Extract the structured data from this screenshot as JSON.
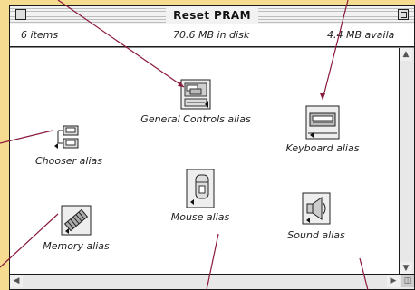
{
  "window": {
    "title": "Reset PRAM",
    "item_count": "6 items",
    "disk_usage": "70.6 MB in disk",
    "available": "4.4 MB availa"
  },
  "icons": [
    {
      "name": "general-controls",
      "label": "General Controls alias"
    },
    {
      "name": "chooser",
      "label": "Chooser alias"
    },
    {
      "name": "keyboard",
      "label": "Keyboard alias"
    },
    {
      "name": "mouse",
      "label": "Mouse alias"
    },
    {
      "name": "memory",
      "label": "Memory alias"
    },
    {
      "name": "sound",
      "label": "Sound alias"
    }
  ],
  "colors": {
    "background": "#f6dc90",
    "pointer_line": "#8a1a3a"
  }
}
